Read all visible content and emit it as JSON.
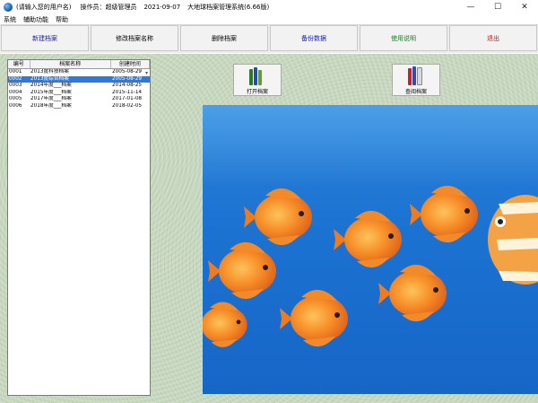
{
  "window": {
    "user": "(请输入您的用户名)",
    "operator": "操作员：超级管理员",
    "date": "2021-09-07",
    "app_title": "大地球档案管理系统(6.66版)",
    "controls": {
      "minimize": "—",
      "maximize": "☐",
      "close": "✕"
    }
  },
  "menu": [
    "系统",
    "辅助功能",
    "帮助"
  ],
  "toolbar": {
    "buttons": [
      {
        "label": "新建档案",
        "color": "#1a1aa8"
      },
      {
        "label": "修改档案名称",
        "color": "#000000"
      },
      {
        "label": "删除档案",
        "color": "#000000"
      },
      {
        "label": "备份数据",
        "color": "#1a1aa8"
      },
      {
        "label": "使用说明",
        "color": "#0c8a1b"
      },
      {
        "label": "退出",
        "color": "#d01010"
      }
    ]
  },
  "list": {
    "headers": [
      "编号",
      "档案名称",
      "创建时间"
    ],
    "rows": [
      {
        "id": "0001",
        "name": "2013度科技档案",
        "date": "2005-08-29",
        "selected": false
      },
      {
        "id": "0002",
        "name": "2013度综合档案",
        "date": "2005-08-29",
        "selected": true
      },
      {
        "id": "0003",
        "name": "2014年度___档案",
        "date": "2014-08-25",
        "selected": false
      },
      {
        "id": "0004",
        "name": "2015年度___档案",
        "date": "2015-11-14",
        "selected": false
      },
      {
        "id": "0005",
        "name": "2017年度___档案",
        "date": "2017-01-08",
        "selected": false
      },
      {
        "id": "0006",
        "name": "2018年度___档案",
        "date": "2018-02-05",
        "selected": false
      }
    ]
  },
  "actions": {
    "open_label": "打开档案",
    "query_label": "查阅档案"
  },
  "colors": {
    "selection": "#2f7ad8",
    "fish_orange": "#f07a1e",
    "water_blue": "#1c73d2"
  }
}
